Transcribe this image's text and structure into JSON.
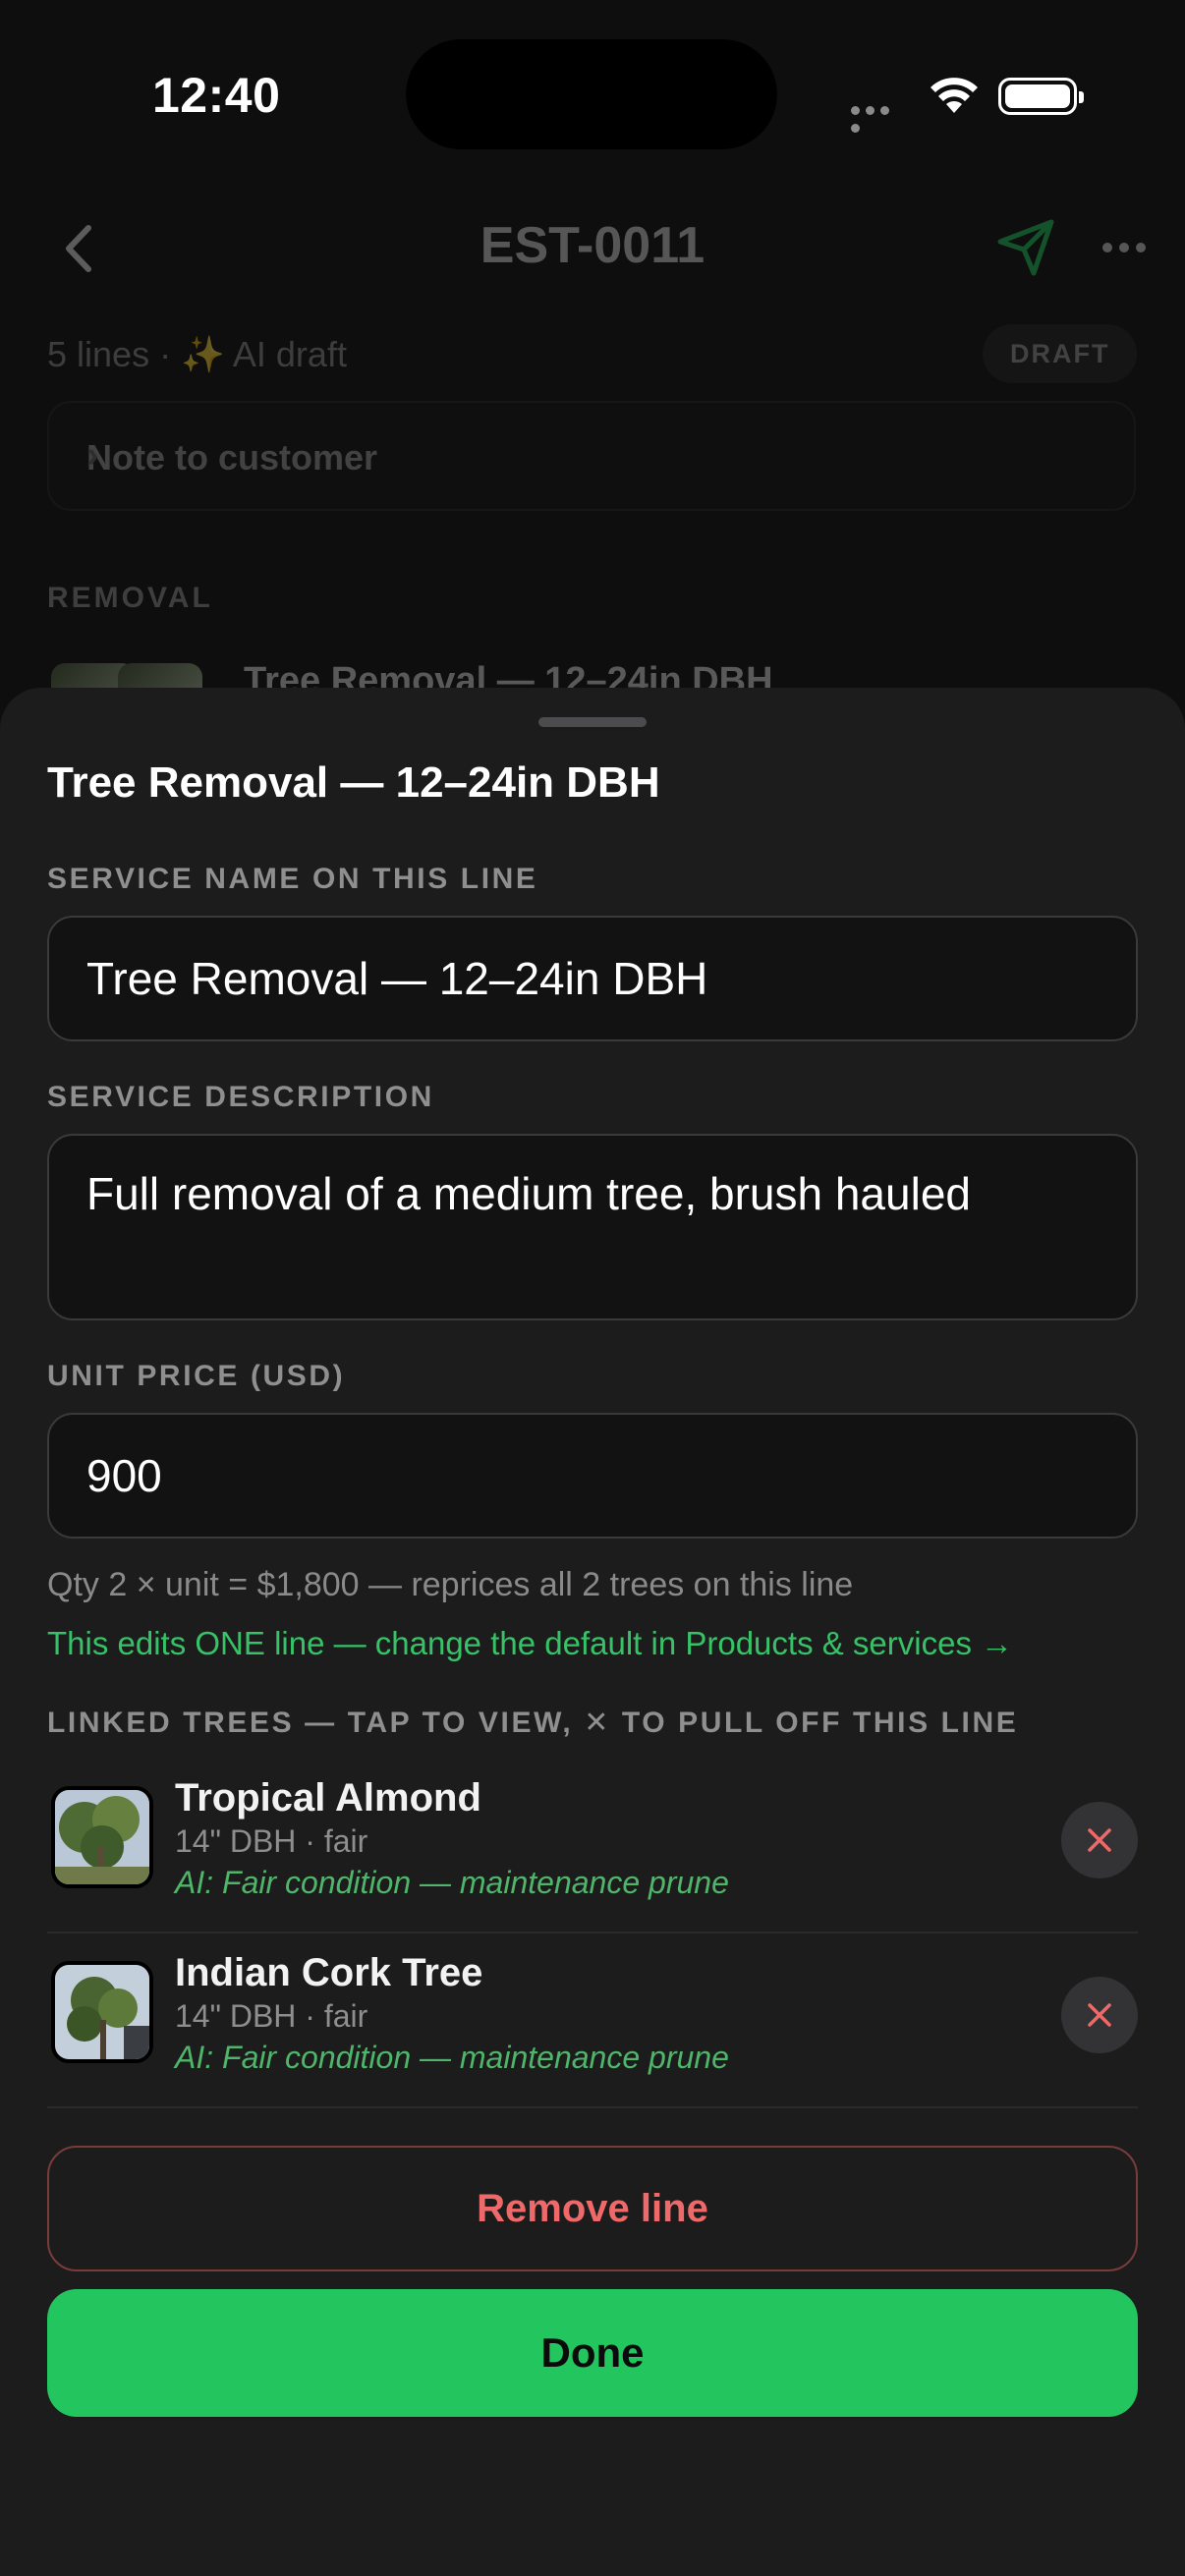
{
  "status_bar": {
    "time": "12:40"
  },
  "header": {
    "title": "EST-0011"
  },
  "summary": {
    "meta": "5 lines · ✨ AI draft",
    "badge": "DRAFT"
  },
  "note": {
    "label": "Note to customer",
    "chevron": "›"
  },
  "section": {
    "label": "REMOVAL",
    "line_title": "Tree Removal — 12–24in DBH"
  },
  "sheet": {
    "title": "Tree Removal — 12–24in DBH",
    "service_name_label": "SERVICE NAME ON THIS LINE",
    "service_name_value": "Tree Removal — 12–24in DBH",
    "service_desc_label": "SERVICE DESCRIPTION",
    "service_desc_value": "Full removal of a medium tree, brush hauled",
    "unit_price_label": "UNIT PRICE (USD)",
    "unit_price_value": "900",
    "qty_hint": "Qty 2 × unit = $1,800 — reprices all 2 trees on this line",
    "edit_hint": "This edits ONE line — change the default in Products & services →",
    "linked_label": "LINKED TREES — TAP TO VIEW, ✕ TO PULL OFF THIS LINE",
    "trees": [
      {
        "name": "Tropical Almond",
        "detail": "14\" DBH · fair",
        "ai": "AI: Fair condition — maintenance prune"
      },
      {
        "name": "Indian Cork Tree",
        "detail": "14\" DBH · fair",
        "ai": "AI: Fair condition — maintenance prune"
      }
    ],
    "remove_label": "Remove line",
    "done_label": "Done"
  },
  "colors": {
    "accent": "#22c55e",
    "danger": "#ee6a6a",
    "sheet_bg": "#1c1c1d"
  },
  "icons": [
    "back-chevron-icon",
    "send-icon",
    "more-icon",
    "close-icon",
    "wifi-icon",
    "battery-icon"
  ]
}
